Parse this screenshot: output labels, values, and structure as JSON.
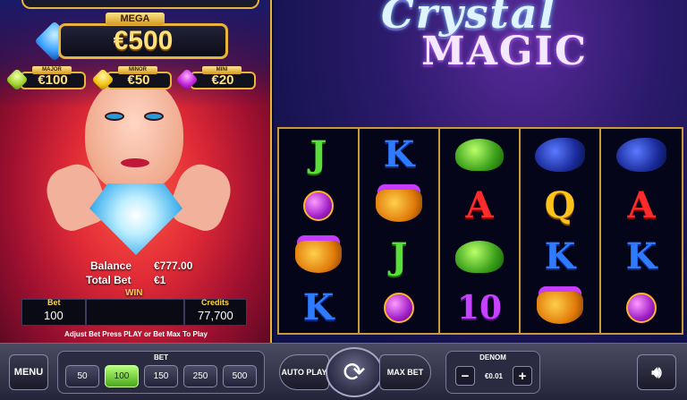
{
  "game": {
    "logo_line1": "Crystal",
    "logo_line2": "MAGIC"
  },
  "jackpots": {
    "mega": {
      "label": "MEGA",
      "value": "€500"
    },
    "major": {
      "label": "MAJOR",
      "value": "€100"
    },
    "minor": {
      "label": "MINOR",
      "value": "€50"
    },
    "mini": {
      "label": "MINI",
      "value": "€20"
    }
  },
  "info": {
    "balance_label": "Balance",
    "balance_value": "€777.00",
    "total_bet_label": "Total Bet",
    "total_bet_value": "€1",
    "win_label": "WIN",
    "win_value": "",
    "bet_label": "Bet",
    "bet_value": "100",
    "credits_label": "Credits",
    "credits_value": "77,700",
    "hint": "Adjust Bet Press PLAY or Bet Max To Play"
  },
  "reels": [
    [
      "J",
      "potion",
      "cauldron",
      "K"
    ],
    [
      "K",
      "cauldron",
      "J",
      "potion"
    ],
    [
      "frog",
      "A",
      "frog",
      "10"
    ],
    [
      "raven",
      "Q",
      "K",
      "cauldron"
    ],
    [
      "raven",
      "A",
      "K",
      "potion"
    ]
  ],
  "controls": {
    "menu_label": "MENU",
    "bet_group_label": "BET",
    "bet_options": [
      "50",
      "100",
      "150",
      "250",
      "500"
    ],
    "bet_selected": "100",
    "autoplay_label": "AUTO PLAY",
    "spin_icon": "spin-arrow-icon",
    "maxbet_label": "MAX BET",
    "denom_label": "DENOM",
    "denom_minus": "−",
    "denom_value": "€0.01",
    "denom_plus": "+",
    "sound_icon": "speaker-icon"
  },
  "colors": {
    "accent_gold": "#e8b43a",
    "selected_bet": "#4aa81a",
    "panel_red": "#e02a36"
  }
}
